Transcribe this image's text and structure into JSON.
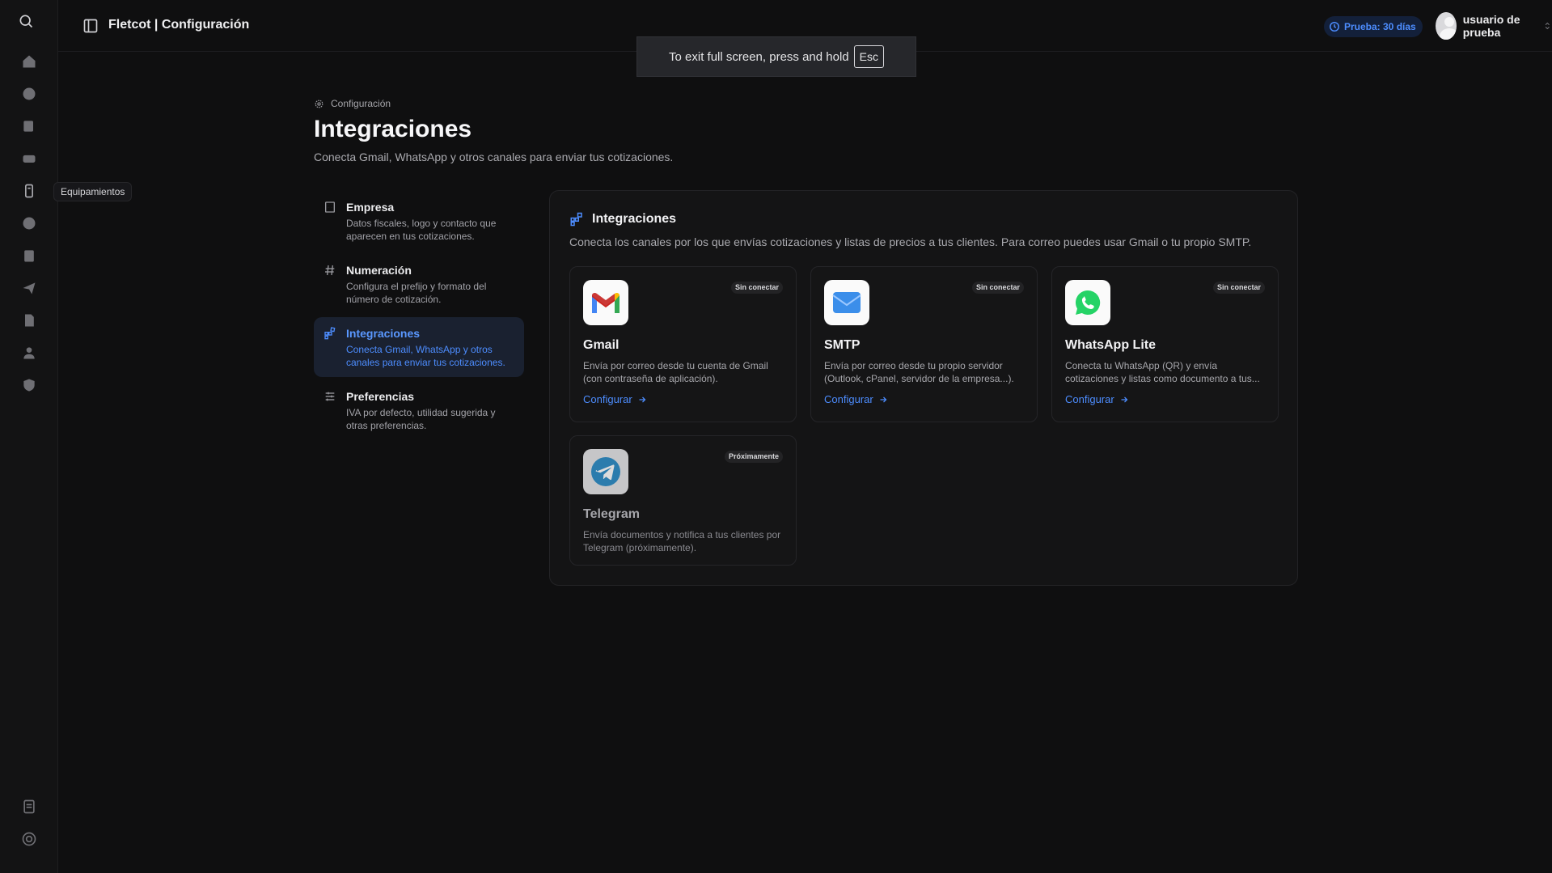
{
  "app": {
    "title": "Fletcot | Configuración",
    "trial_label": "Prueba: 30 días",
    "user_name": "usuario de prueba"
  },
  "fullscreen_notice": {
    "text": "To exit full screen, press and hold",
    "key": "Esc"
  },
  "rail": {
    "tooltip": "Equipamientos",
    "icons": [
      "search-icon",
      "home-icon",
      "globe-icon",
      "edit-icon",
      "vehicle-icon",
      "equipment-icon",
      "dollar-icon",
      "clipboard-icon",
      "send-icon",
      "file-icon",
      "user-icon",
      "shield-icon",
      "notes-icon",
      "support-icon"
    ]
  },
  "page": {
    "breadcrumb": "Configuración",
    "title": "Integraciones",
    "subtitle": "Conecta Gmail, WhatsApp y otros canales para enviar tus cotizaciones."
  },
  "nav": [
    {
      "title": "Empresa",
      "desc": "Datos fiscales, logo y contacto que aparecen en tus cotizaciones.",
      "icon": "building-icon"
    },
    {
      "title": "Numeración",
      "desc": "Configura el prefijo y formato del número de cotización.",
      "icon": "hash-icon"
    },
    {
      "title": "Integraciones",
      "desc": "Conecta Gmail, WhatsApp y otros canales para enviar tus cotizaciones.",
      "icon": "integrations-icon",
      "active": true
    },
    {
      "title": "Preferencias",
      "desc": "IVA por defecto, utilidad sugerida y otras preferencias.",
      "icon": "sliders-icon"
    }
  ],
  "panel": {
    "title": "Integraciones",
    "subtitle": "Conecta los canales por los que envías cotizaciones y listas de precios a tus clientes. Para correo puedes usar Gmail o tu propio SMTP."
  },
  "cards": [
    {
      "name": "Gmail",
      "badge": "Sin conectar",
      "desc": "Envía por correo desde tu cuenta de Gmail (con contraseña de aplicación).",
      "action": "Configurar"
    },
    {
      "name": "SMTP",
      "badge": "Sin conectar",
      "desc": "Envía por correo desde tu propio servidor (Outlook, cPanel, servidor de la empresa...).",
      "action": "Configurar"
    },
    {
      "name": "WhatsApp Lite",
      "badge": "Sin conectar",
      "desc": "Conecta tu WhatsApp (QR) y envía cotizaciones y listas como documento a tus...",
      "action": "Configurar"
    },
    {
      "name": "Telegram",
      "badge": "Próximamente",
      "desc": "Envía documentos y notifica a tus clientes por Telegram (próximamente)."
    }
  ],
  "colors": {
    "accent": "#4d8dff",
    "background": "#0f0f10",
    "active_nav_bg": "#1a2130"
  }
}
